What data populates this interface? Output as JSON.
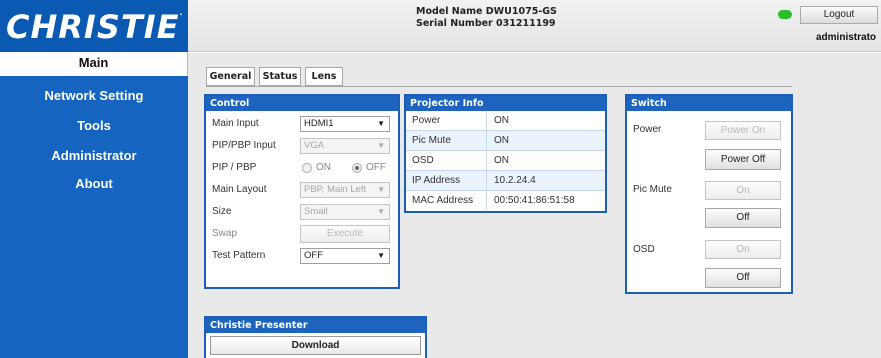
{
  "brand": {
    "logo_text": "CHRISTIE",
    "logo_mark": "."
  },
  "sidebar": {
    "items": [
      {
        "label": "Main"
      },
      {
        "label": "Network Setting"
      },
      {
        "label": "Tools"
      },
      {
        "label": "Administrator"
      },
      {
        "label": "About"
      }
    ]
  },
  "header": {
    "model_name": "Model Name DWU1075-GS",
    "serial_number": "Serial Number 031211199",
    "status_color": "#28c028",
    "logout_label": "Logout",
    "user": "administrato"
  },
  "tabs": [
    {
      "label": "General"
    },
    {
      "label": "Status"
    },
    {
      "label": "Lens"
    }
  ],
  "control": {
    "title": "Control",
    "main_input": {
      "label": "Main Input",
      "value": "HDMI1"
    },
    "pip_pbp_input": {
      "label": "PIP/PBP Input",
      "value": "VGA"
    },
    "pip_pbp": {
      "label": "PIP / PBP",
      "on_label": "ON",
      "off_label": "OFF",
      "selected": "OFF"
    },
    "main_layout": {
      "label": "Main Layout",
      "value": "PBP, Main Left"
    },
    "size": {
      "label": "Size",
      "value": "Small"
    },
    "swap": {
      "label": "Swap",
      "button": "Execute"
    },
    "test_pattern": {
      "label": "Test Pattern",
      "value": "OFF"
    }
  },
  "projector_info": {
    "title": "Projector Info",
    "rows": [
      {
        "key": "Power",
        "value": "ON"
      },
      {
        "key": "Pic Mute",
        "value": "ON"
      },
      {
        "key": "OSD",
        "value": "ON"
      },
      {
        "key": "IP Address",
        "value": "10.2.24.4"
      },
      {
        "key": "MAC Address",
        "value": "00:50:41:86:51:58"
      }
    ]
  },
  "switch": {
    "title": "Switch",
    "power": {
      "label": "Power",
      "on_button": "Power On",
      "off_button": "Power Off"
    },
    "pic_mute": {
      "label": "Pic Mute",
      "on_button": "On",
      "off_button": "Off"
    },
    "osd": {
      "label": "OSD",
      "on_button": "On",
      "off_button": "Off"
    }
  },
  "presenter": {
    "title": "Christie Presenter",
    "download_label": "Download"
  },
  "colors": {
    "sidebar_blue": "#1464c0",
    "panel_blue": "#1e63bd",
    "status_green": "#28c028"
  }
}
